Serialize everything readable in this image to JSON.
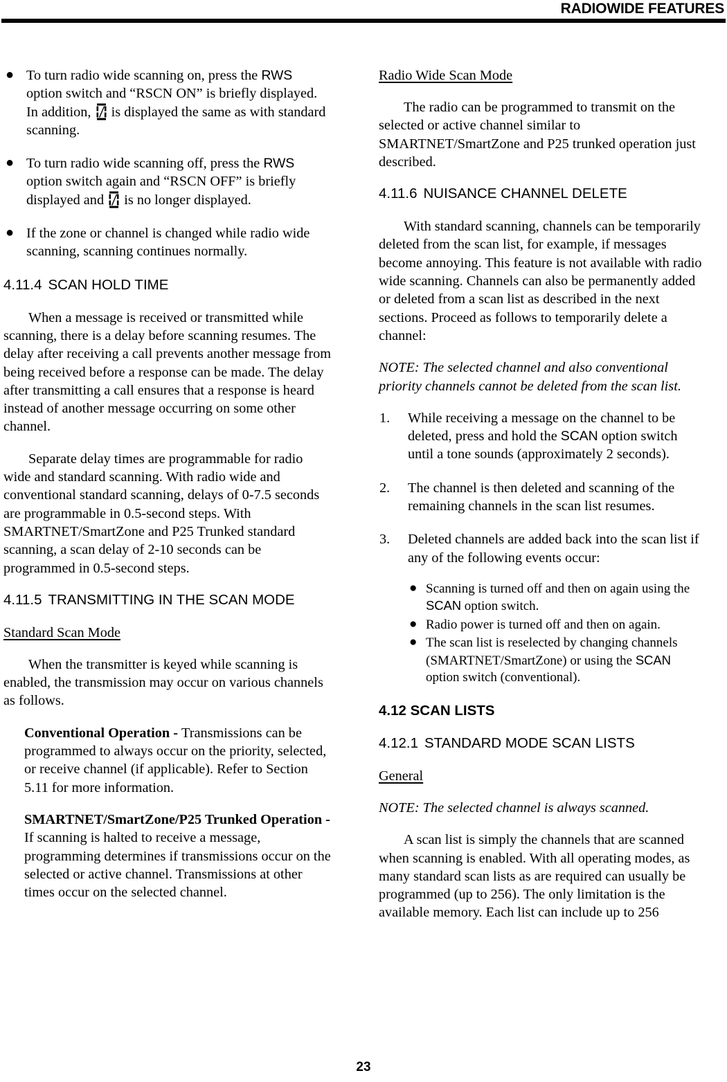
{
  "header": {
    "title": "RADIOWIDE FEATURES"
  },
  "footer": {
    "page_number": "23"
  },
  "icons": {
    "scan_indicator": "scan-indicator-icon"
  },
  "left_column": {
    "bullets": [
      {
        "part1": "To turn radio wide scanning on, press the ",
        "switch1": "RWS",
        "part2": " option switch and “RSCN ON” is briefly displayed. In addition, ",
        "part3": " is displayed the same as with standard scanning."
      },
      {
        "part1": "To turn radio wide scanning off, press the ",
        "switch1": "RWS",
        "part2": " option switch again and “RSCN OFF” is briefly displayed and ",
        "part3": " is no longer displayed."
      },
      {
        "part1": "If the zone or channel is changed while radio wide scanning, scanning continues normally.",
        "switch1": "",
        "part2": "",
        "part3": ""
      }
    ],
    "section_4114": {
      "number": "4.11.4",
      "title": "SCAN HOLD TIME"
    },
    "para_hold_1": "When a message is received or transmitted while scanning, there is a delay before scanning resumes. The delay after receiving a call prevents another message from being received before a response can be made. The delay after transmitting a call ensures that a response is heard instead of another message occurring on some other channel.",
    "para_hold_2": "Separate delay times are programmable for radio wide and standard scanning. With radio wide and conventional standard scanning, delays of 0-7.5 seconds are programmable in 0.5-second steps. With SMARTNET/SmartZone and P25 Trunked standard scanning, a scan delay of 2-10 seconds can be programmed in 0.5-second steps.",
    "section_4115": {
      "number": "4.11.5",
      "title": "TRANSMITTING IN THE SCAN MODE"
    },
    "subhead_standard_scan_mode": "Standard Scan Mode",
    "para_transmitter": "When the transmitter is keyed while scanning is enabled, the transmission may occur on various channels as follows.",
    "def_conventional": {
      "lead": "Conventional Operation - ",
      "body": "Transmissions can be programmed to always occur on the priority, selected, or receive channel (if applicable). Refer to Section 5.11 for more information."
    },
    "def_smartnet": {
      "lead": "SMARTNET/SmartZone/P25 Trunked Operation - ",
      "body": "If scanning is halted to receive a message, programming determines if transmissions occur on the selected or active channel. Transmissions at other times occur on the selected channel."
    }
  },
  "right_column": {
    "subhead_radio_wide_scan_mode": "Radio Wide Scan Mode",
    "para_radio_wide": "The radio can be programmed to transmit on the selected or active channel similar to SMARTNET/SmartZone and P25 trunked operation just described.",
    "section_4116": {
      "number": "4.11.6",
      "title": "NUISANCE CHANNEL DELETE"
    },
    "para_nuisance": "With standard scanning, channels can be temporarily deleted from the scan list, for example, if messages become annoying. This feature is not available with radio wide scanning. Channels can also be permanently added or deleted from a scan list as described in the next sections. Proceed as follows to temporarily delete a channel:",
    "note_delete": "NOTE: The selected channel and also conventional priority channels cannot be deleted from the scan list.",
    "steps": [
      {
        "index": "1.",
        "part1": "While receiving a message on the channel to be deleted, press and hold the ",
        "switch": "SCAN",
        "part2": " option switch until a tone sounds (approximately 2 seconds)."
      },
      {
        "index": "2.",
        "part1": "The channel is then deleted and scanning of the remaining channels in the scan list resumes.",
        "switch": "",
        "part2": ""
      },
      {
        "index": "3.",
        "part1": "Deleted channels are added back into the scan list if any of the following events occur:",
        "switch": "",
        "part2": ""
      }
    ],
    "step3_bullets": [
      {
        "part1": "Scanning is turned off and then on again using the ",
        "switch": "SCAN",
        "part2": " option switch."
      },
      {
        "part1": "Radio power is turned off and then on again.",
        "switch": "",
        "part2": ""
      },
      {
        "part1": "The scan list is reselected by changing channels (SMARTNET/SmartZone) or using the ",
        "switch": "SCAN",
        "part2": " option switch (conventional)."
      }
    ],
    "section_412": {
      "text": "4.12 SCAN LISTS"
    },
    "section_4121": {
      "number": "4.12.1",
      "title": "STANDARD MODE SCAN LISTS"
    },
    "subhead_general": "General",
    "note_general": "NOTE: The selected channel is always scanned.",
    "para_scan_list": "A scan list is simply the channels that are scanned when scanning is enabled. With all operating modes, as many standard scan lists as are required can usually be programmed (up to 256). The only limitation is the available memory. Each list can include up to 256"
  }
}
